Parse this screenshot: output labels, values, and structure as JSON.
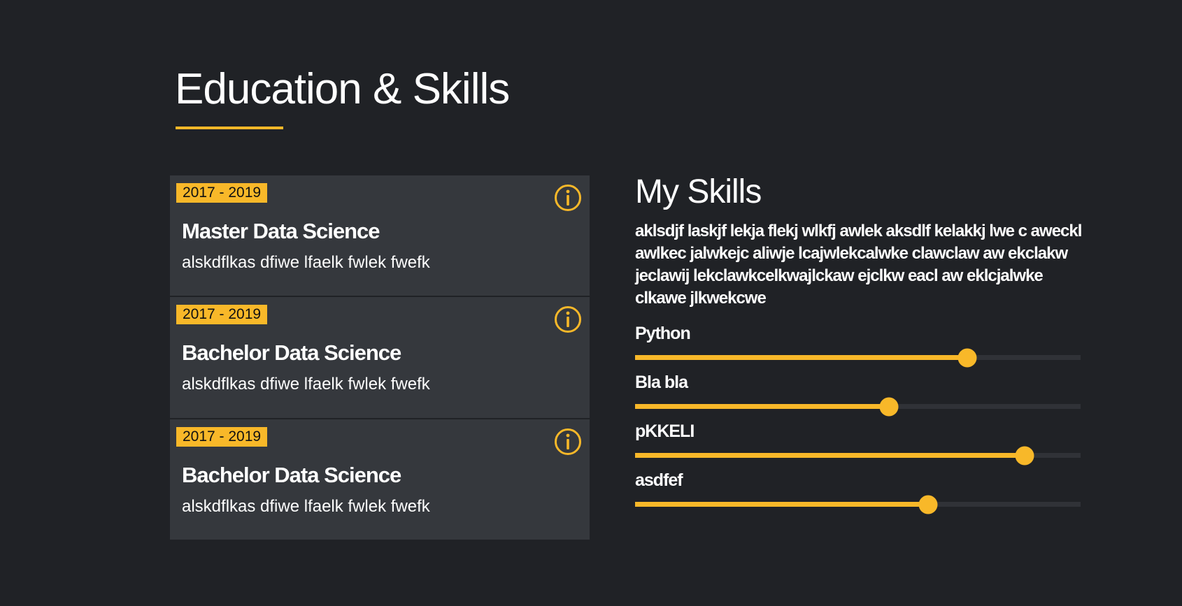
{
  "education": {
    "title": "Education & Skills",
    "accent_color": "#f8b829",
    "items": [
      {
        "date": "2017 - 2019",
        "degree": "Master Data Science",
        "description": "alskdflkas dfiwe lfaelk fwlek fwefk",
        "icon": "info-icon"
      },
      {
        "date": "2017 - 2019",
        "degree": "Bachelor Data Science",
        "description": "alskdflkas dfiwe lfaelk fwlek fwefk",
        "icon": "info-icon"
      },
      {
        "date": "2017 - 2019",
        "degree": "Bachelor Data Science",
        "description": "alskdflkas dfiwe lfaelk fwlek fwefk",
        "icon": "info-icon"
      }
    ]
  },
  "skills": {
    "title": "My Skills",
    "description": "aklsdjf laskjf lekja flekj wlkfj awlek  aksdlf kelakkj lwe c aweckl awlkec jalwkejc aliwje lcajwlekcalwke clawclaw aw ekclakw jeclawij lekclawkcelkwajlckaw ejclkw eacl aw eklcjalwke clkawe jlkwekcwe",
    "items": [
      {
        "name": "Python",
        "level": 0.745
      },
      {
        "name": "Bla bla",
        "level": 0.57
      },
      {
        "name": "pKKELI",
        "level": 0.875
      },
      {
        "name": "asdfef",
        "level": 0.657
      }
    ]
  }
}
